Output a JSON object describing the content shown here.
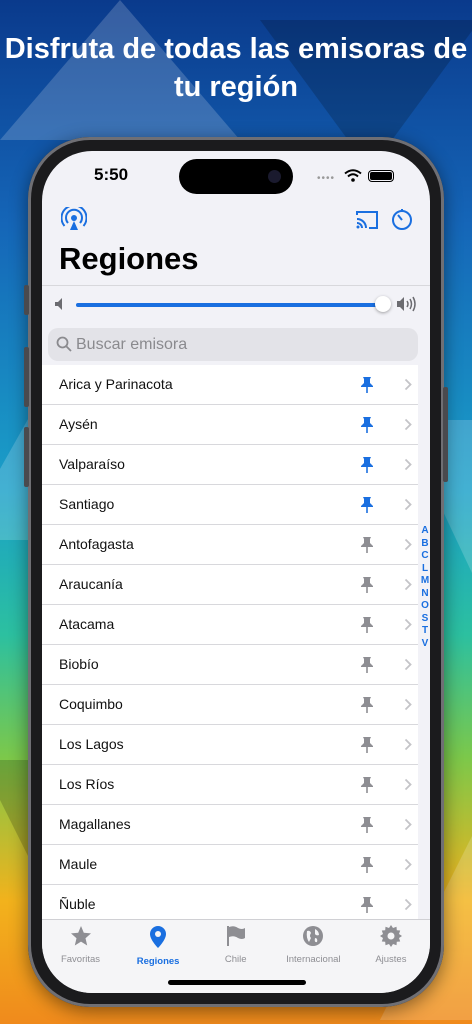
{
  "headline": "Disfruta de todas las emisoras de tu región",
  "status_bar": {
    "time": "5:50",
    "signal_icon": "signal-dots-icon",
    "wifi_icon": "wifi-icon",
    "battery_icon": "battery-icon"
  },
  "toolbar": {
    "left_icon": "radio-broadcast-icon",
    "cast_icon": "cast-icon",
    "timer_icon": "sleep-timer-icon"
  },
  "page_title": "Regiones",
  "volume": {
    "level": 1.0,
    "min_icon": "speaker-low-icon",
    "max_icon": "speaker-high-icon"
  },
  "search": {
    "placeholder": "Buscar emisora",
    "value": ""
  },
  "regions": [
    {
      "name": "Arica y Parinacota",
      "pinned": true
    },
    {
      "name": "Aysén",
      "pinned": true
    },
    {
      "name": "Valparaíso",
      "pinned": true
    },
    {
      "name": "Santiago",
      "pinned": true
    },
    {
      "name": "Antofagasta",
      "pinned": false
    },
    {
      "name": "Araucanía",
      "pinned": false
    },
    {
      "name": "Atacama",
      "pinned": false
    },
    {
      "name": "Biobío",
      "pinned": false
    },
    {
      "name": "Coquimbo",
      "pinned": false
    },
    {
      "name": "Los Lagos",
      "pinned": false
    },
    {
      "name": "Los Ríos",
      "pinned": false
    },
    {
      "name": "Magallanes",
      "pinned": false
    },
    {
      "name": "Maule",
      "pinned": false
    },
    {
      "name": "Ñuble",
      "pinned": false
    }
  ],
  "index_letters": [
    "A",
    "B",
    "C",
    "L",
    "M",
    "N",
    "O",
    "S",
    "T",
    "V"
  ],
  "tabs": [
    {
      "label": "Favoritas",
      "icon": "star-icon",
      "active": false
    },
    {
      "label": "Regiones",
      "icon": "location-pin-icon",
      "active": true
    },
    {
      "label": "Chile",
      "icon": "flag-icon",
      "active": false
    },
    {
      "label": "Internacional",
      "icon": "globe-icon",
      "active": false
    },
    {
      "label": "Ajustes",
      "icon": "gear-icon",
      "active": false
    }
  ],
  "colors": {
    "accent": "#1a6fe0",
    "pin_inactive": "#8e8e93",
    "background": "#f2f2f7"
  }
}
